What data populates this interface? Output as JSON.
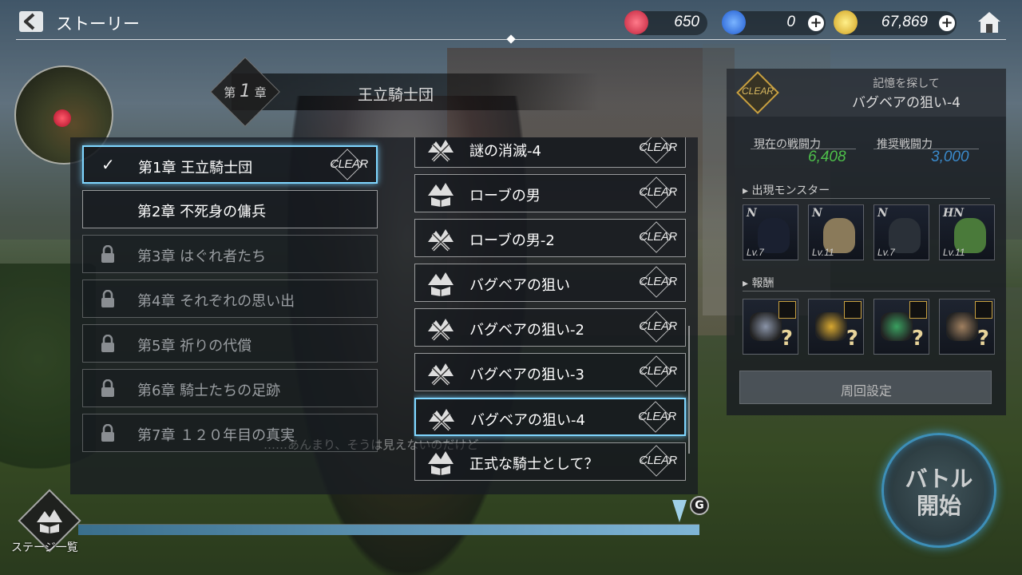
{
  "header": {
    "title": "ストーリー",
    "currencies": [
      {
        "name": "ruby",
        "value": "650",
        "color": "#e0304a"
      },
      {
        "name": "sapphire",
        "value": "0",
        "color": "#2f74e0"
      },
      {
        "name": "gold",
        "value": "67,869",
        "color": "#e8c230"
      }
    ]
  },
  "chapter_header": {
    "prefix": "第",
    "number": "1",
    "suffix": "章",
    "title": "王立騎士団"
  },
  "chapters": [
    {
      "label": "第1章 王立騎士団",
      "state": "selected",
      "clear": "CLEAR"
    },
    {
      "label": "第2章 不死身の傭兵",
      "state": "open",
      "clear": ""
    },
    {
      "label": "第3章 はぐれ者たち",
      "state": "locked",
      "clear": ""
    },
    {
      "label": "第4章 それぞれの思い出",
      "state": "locked",
      "clear": ""
    },
    {
      "label": "第5章 祈りの代償",
      "state": "locked",
      "clear": ""
    },
    {
      "label": "第6章 騎士たちの足跡",
      "state": "locked",
      "clear": ""
    },
    {
      "label": "第7章 １２０年目の真実",
      "state": "locked",
      "clear": ""
    }
  ],
  "stages": [
    {
      "label": "謎の消滅-4",
      "icon": "battle-icon",
      "clear": "CLEAR"
    },
    {
      "label": "ローブの男",
      "icon": "story-book-icon",
      "clear": "CLEAR"
    },
    {
      "label": "ローブの男-2",
      "icon": "battle-icon",
      "clear": "CLEAR"
    },
    {
      "label": "バグベアの狙い",
      "icon": "story-book-icon",
      "clear": "CLEAR"
    },
    {
      "label": "バグベアの狙い-2",
      "icon": "battle-icon",
      "clear": "CLEAR"
    },
    {
      "label": "バグベアの狙い-3",
      "icon": "battle-icon",
      "clear": "CLEAR"
    },
    {
      "label": "バグベアの狙い-4",
      "icon": "battle-icon",
      "clear": "CLEAR",
      "selected": true
    },
    {
      "label": "正式な騎士として？",
      "icon": "story-book-icon",
      "clear": "CLEAR"
    }
  ],
  "subtitle": "……あんまり、そうは見えないのだけど",
  "progress": {
    "fraction": 1.0,
    "badge": "G"
  },
  "stage_list_button": {
    "label": "ステージ一覧"
  },
  "info": {
    "clear_badge": "CLEAR",
    "subtitle": "記憶を探して",
    "title": "バグベアの狙い-4",
    "current_power_label": "現在の戦闘力",
    "current_power": "6,408",
    "recommended_power_label": "推奨戦闘力",
    "recommended_power": "3,000",
    "monsters_label": "出現モンスター",
    "monsters": [
      {
        "rank": "N",
        "level": "Lv.7",
        "color": "#1a2030"
      },
      {
        "rank": "N",
        "level": "Lv.11",
        "color": "#8a7a5a"
      },
      {
        "rank": "N",
        "level": "Lv.7",
        "color": "#2a3038"
      },
      {
        "rank": "HN",
        "level": "Lv.11",
        "color": "#4a7a3a"
      }
    ],
    "rewards_label": "報酬",
    "rewards": [
      {
        "q": "?",
        "color": "#8a94a8"
      },
      {
        "q": "?",
        "color": "#d8a830"
      },
      {
        "q": "?",
        "color": "#3aa060"
      },
      {
        "q": "?",
        "color": "#a08060"
      }
    ],
    "cycle_button": "周回設定"
  },
  "battle_button": {
    "line1": "バトル",
    "line2": "開始"
  }
}
